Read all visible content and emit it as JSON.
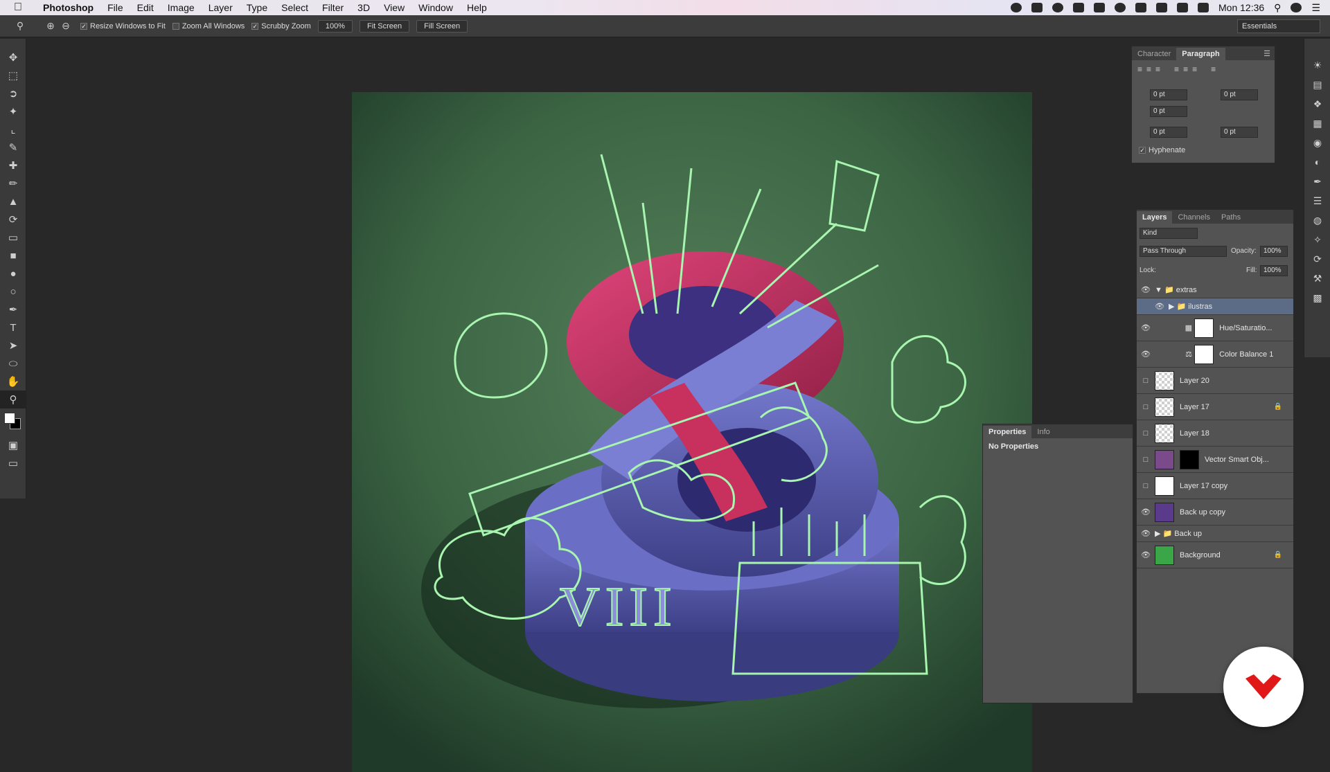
{
  "menubar": {
    "app": "Photoshop",
    "items": [
      "File",
      "Edit",
      "Image",
      "Layer",
      "Type",
      "Select",
      "Filter",
      "3D",
      "View",
      "Window",
      "Help"
    ],
    "clock": "Mon 12:36"
  },
  "options": {
    "resize_windows": "Resize Windows to Fit",
    "zoom_all": "Zoom All Windows",
    "scrubby": "Scrubby Zoom",
    "zoom_value": "100%",
    "fit_screen": "Fit Screen",
    "fill_screen": "Fill Screen",
    "workspace": "Essentials"
  },
  "paragraph_panel": {
    "tabs": [
      "Character",
      "Paragraph"
    ],
    "indent_left": "0 pt",
    "indent_right": "0 pt",
    "indent_first": "0 pt",
    "space_before": "0 pt",
    "space_after": "0 pt",
    "hyphenate": "Hyphenate"
  },
  "layers_panel": {
    "tabs": [
      "Layers",
      "Channels",
      "Paths"
    ],
    "kind": "Kind",
    "blend": "Pass Through",
    "opacity_label": "Opacity:",
    "opacity": "100%",
    "lock_label": "Lock:",
    "fill_label": "Fill:",
    "fill": "100%",
    "layers": [
      {
        "name": "extras",
        "type": "group-open",
        "visible": true
      },
      {
        "name": "ilustras",
        "type": "group",
        "visible": true,
        "selected": true
      },
      {
        "name": "Hue/Saturatio...",
        "type": "adjustment",
        "visible": true
      },
      {
        "name": "Color Balance 1",
        "type": "adjustment",
        "visible": true
      },
      {
        "name": "Layer 20",
        "type": "pixel",
        "visible": false
      },
      {
        "name": "Layer 17",
        "type": "pixel",
        "visible": false,
        "locked": true
      },
      {
        "name": "Layer 18",
        "type": "pixel",
        "visible": false
      },
      {
        "name": "Vector Smart Obj...",
        "type": "smart",
        "visible": false
      },
      {
        "name": "Layer 17 copy",
        "type": "pixel",
        "visible": false
      },
      {
        "name": "Back up copy",
        "type": "pixel",
        "visible": true
      },
      {
        "name": "Back up",
        "type": "group",
        "visible": true
      },
      {
        "name": "Background",
        "type": "pixel",
        "visible": true,
        "locked": true
      }
    ]
  },
  "properties_panel": {
    "tabs": [
      "Properties",
      "Info"
    ],
    "message": "No Properties"
  },
  "canvas": {
    "numeral": "VIII",
    "colors": {
      "bg": "#3f6a46",
      "pink": "#c8305e",
      "blue": "#5b5fb0",
      "line": "#a8f5b0"
    }
  }
}
